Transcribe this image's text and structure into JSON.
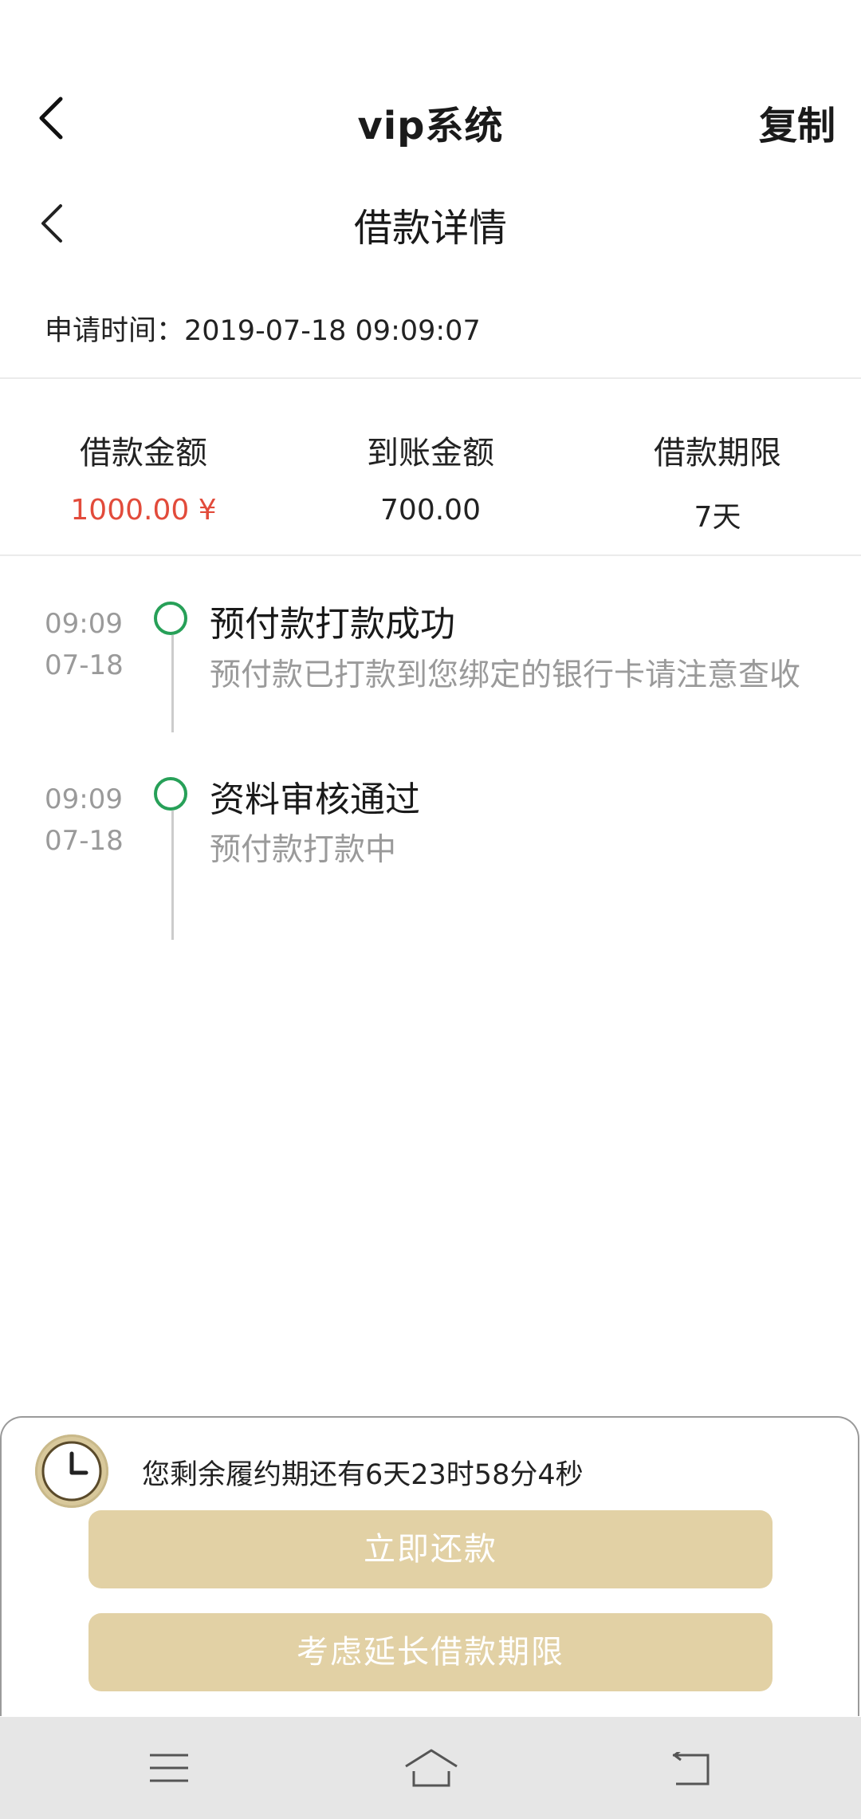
{
  "app_bar": {
    "title": "vip系统",
    "copy_label": "复制"
  },
  "page": {
    "title": "借款详情",
    "apply_time": "申请时间：2019-07-18 09:09:07"
  },
  "summary": [
    {
      "label": "借款金额",
      "value": "1000.00 ¥"
    },
    {
      "label": "到账金额",
      "value": "700.00"
    },
    {
      "label": "借款期限",
      "value": "7天"
    }
  ],
  "timeline": [
    {
      "time": "09:09",
      "date": "07-18",
      "title": "预付款打款成功",
      "desc": "预付款已打款到您绑定的银行卡请注意查收"
    },
    {
      "time": "09:09",
      "date": "07-18",
      "title": "资料审核通过",
      "desc": "预付款打款中"
    }
  ],
  "bottom": {
    "countdown": "您剩余履约期还有6天23时58分4秒",
    "repay_label": "立即还款",
    "extend_label": "考虑延长借款期限"
  },
  "colors": {
    "accent_button": "#e2d1a5",
    "amount_red": "#e24b3b",
    "timeline_green": "#27a058"
  },
  "icons": [
    "back-icon",
    "clock-icon",
    "menu-icon",
    "home-icon",
    "return-icon"
  ]
}
